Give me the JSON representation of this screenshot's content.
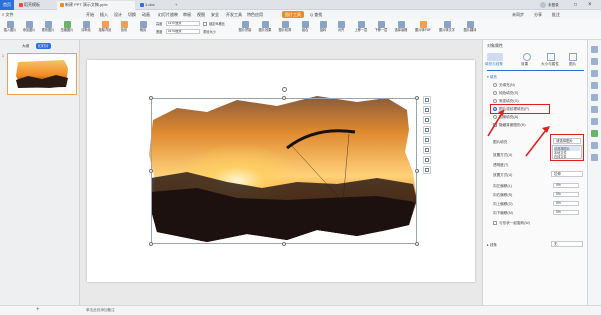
{
  "tabs": {
    "home": "首页",
    "items": [
      {
        "label": "稻壳模板",
        "color": "#e84a3a"
      },
      {
        "label": "新建 PPT 演示文稿.pptx",
        "color": "#f08a24"
      },
      {
        "label": "1.doc",
        "color": "#2b6fd8"
      }
    ],
    "plus": "+"
  },
  "window": {
    "login": "未登录",
    "restore": "□",
    "close": "×"
  },
  "menu": {
    "file": "≡ 文件",
    "items": [
      "开始",
      "插入",
      "设计",
      "切换",
      "动画",
      "幻灯片放映",
      "审阅",
      "视图",
      "安全",
      "开发工具",
      "特色应用"
    ],
    "active": "图片工具",
    "search": "Q 查找",
    "right": [
      "未同步",
      "分享",
      "批注"
    ]
  },
  "ribbon": {
    "buttons": [
      "插入图片",
      "添加图片",
      "更改图片",
      "压缩图片",
      "清晰化",
      "抠除背景",
      "色彩",
      "裁剪",
      "重设大小",
      "图片拼接"
    ],
    "height_label": "高度",
    "height_value": "12.67厘米",
    "width_label": "宽度",
    "width_value": "22.53厘米",
    "lock_ratio": "锁定纵横比",
    "reset_size": "重设大小",
    "right_buttons": [
      "图片效果",
      "图片轮廓",
      "组合",
      "旋转",
      "对齐",
      "上移一层",
      "下移一层",
      "选择窗格",
      "图片转PDF",
      "图片转文字",
      "图片翻译"
    ]
  },
  "left_panel": {
    "tab_outline": "大纲",
    "tab_slides": "幻灯片",
    "slide_number": "1"
  },
  "status_bar": {
    "note": "单击此处添加备注"
  },
  "properties": {
    "header": "对象属性",
    "tabs": [
      "填充与线条",
      "效果",
      "大小与属性",
      "图片"
    ],
    "section_fill": "填充",
    "fill_options": [
      "无填充(N)",
      "纯色填充(S)",
      "渐变填充(G)",
      "图片或纹理填充(P)",
      "图案填充(A)"
    ],
    "selected_fill": "图片或纹理填充(P)",
    "hide_bg": "隐藏背景图形(H)",
    "image_fill_label": "图片填充",
    "image_fill_value": "请选择图片",
    "dropdown_options": [
      "请选择图片",
      "本地文件",
      "在线文件"
    ],
    "offset_label": "放置方式(U)",
    "transparency_label": "透明度(T)",
    "transparency_value": "0%",
    "placement_label": "放置方式(U)",
    "placement_value": "拉伸",
    "offsets": [
      {
        "label": "向左偏移(L)",
        "value": "0%"
      },
      {
        "label": "向右偏移(R)",
        "value": "0%"
      },
      {
        "label": "向上偏移(O)",
        "value": "0%"
      },
      {
        "label": "向下偏移(M)",
        "value": "0%"
      }
    ],
    "rotate_with_shape": "与形状一起旋转(W)",
    "line_section": "线条",
    "line_value": "无"
  },
  "colors": {
    "accent": "#2b6fd8",
    "orange": "#f08a24",
    "red": "#e02020"
  }
}
